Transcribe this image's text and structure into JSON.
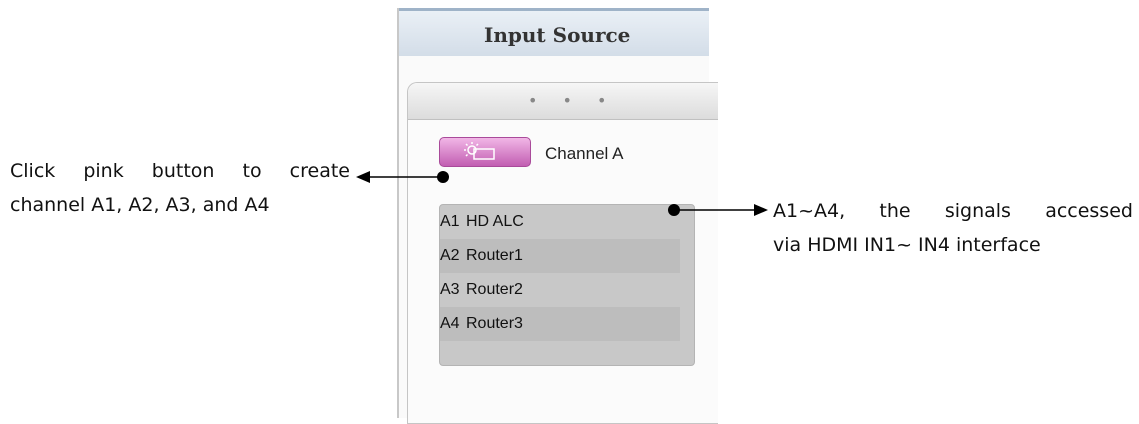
{
  "annotations": {
    "left_line1_words": [
      "Click",
      "pink",
      "button",
      "to",
      "create"
    ],
    "left_line2": "channel A1, A2, A3, and A4",
    "right_line1_words": [
      "A1~A4,",
      "the",
      "signals",
      "accessed"
    ],
    "right_line2": "via HDMI IN1~ IN4 interface"
  },
  "panel": {
    "title": "Input Source",
    "dots": "• • •",
    "create_button_icon": "sun-icon",
    "channel_label": "Channel A",
    "items": [
      {
        "code": "A1",
        "name": "HD ALC"
      },
      {
        "code": "A2",
        "name": "Router1"
      },
      {
        "code": "A3",
        "name": "Router2"
      },
      {
        "code": "A4",
        "name": "Router3"
      }
    ]
  },
  "colors": {
    "button_pink": "#c25eb2",
    "list_bg": "#c8c8c8",
    "title_bar": "#d3dde8"
  }
}
